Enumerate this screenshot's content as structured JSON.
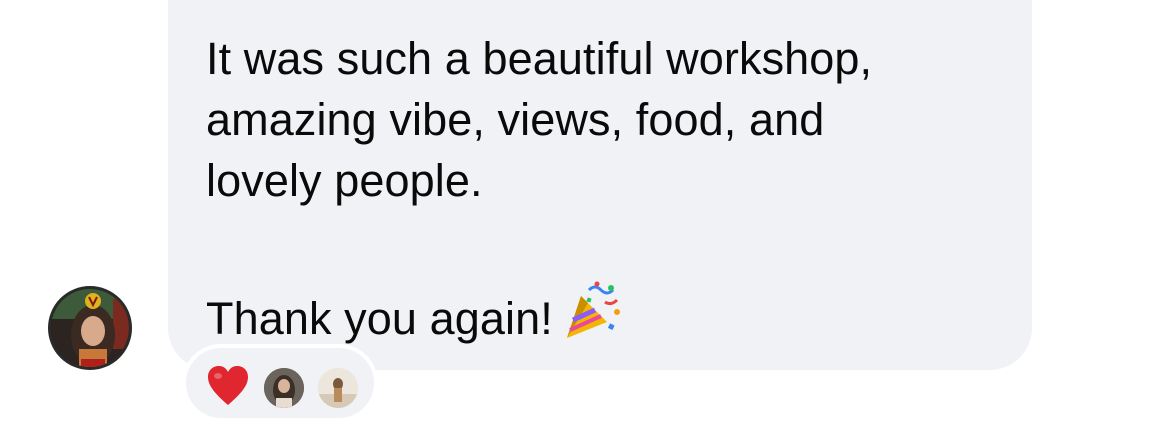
{
  "message": {
    "lines": [
      "It was such a beautiful workshop,",
      "amazing vibe, views, food, and",
      "lovely people.",
      "Thank you again!"
    ],
    "emoji": "party-popper-icon"
  },
  "sender": {
    "avatar": "avatar-photo"
  },
  "reactions": {
    "emoji": "heart-icon",
    "reactor_avatars": [
      "reactor-avatar-1",
      "reactor-avatar-2"
    ]
  },
  "colors": {
    "bubble_bg": "#f0f2f5",
    "text": "#0a0a0a",
    "heart": "#e0262f",
    "page_bg": "#ffffff"
  }
}
